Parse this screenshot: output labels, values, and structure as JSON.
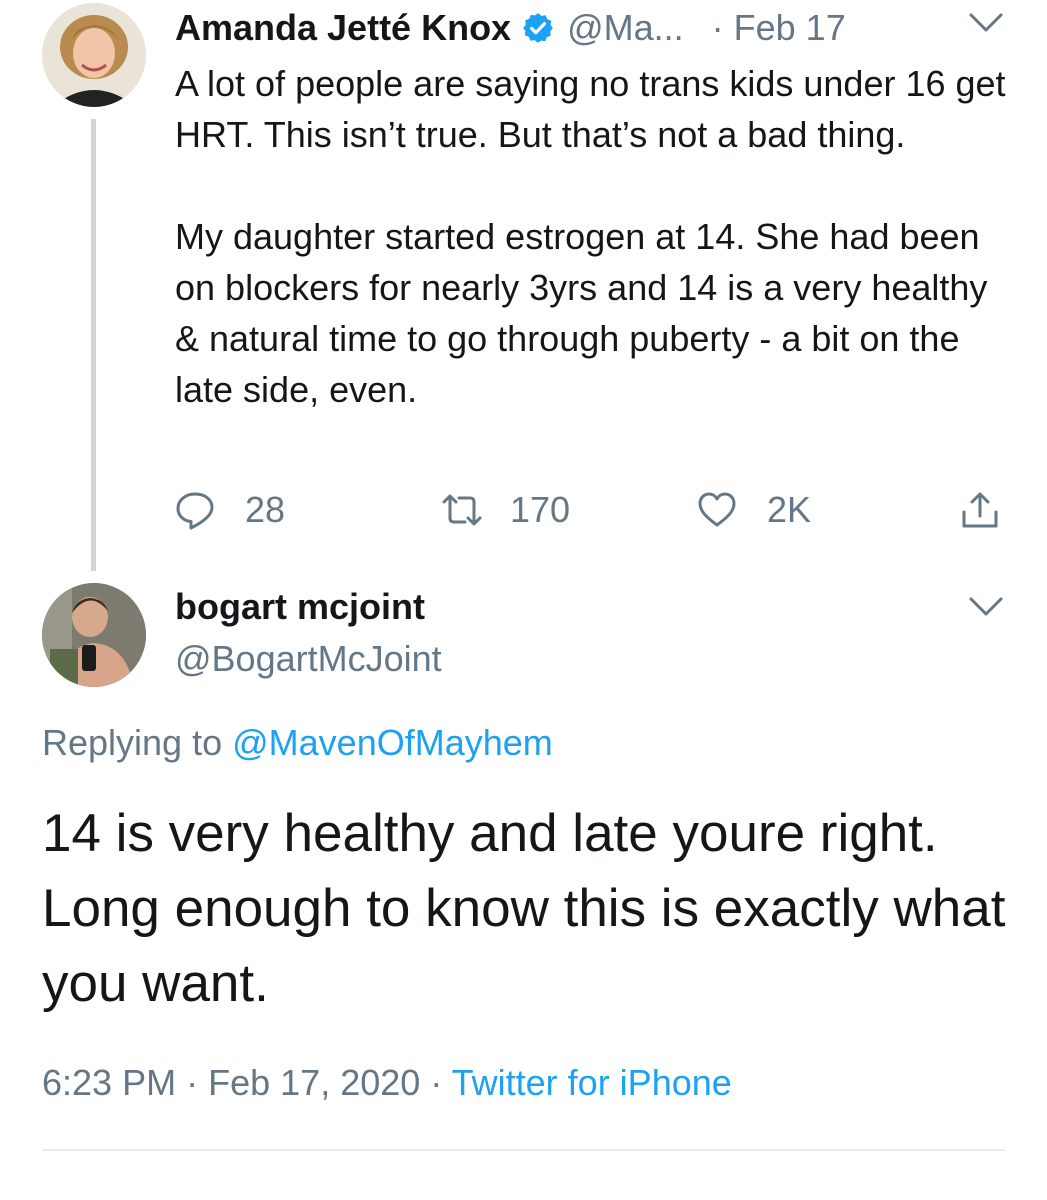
{
  "parent_tweet": {
    "author_name": "Amanda Jetté Knox",
    "author_handle": "@Ma...",
    "separator": "·",
    "date": "Feb 17",
    "text_paragraphs": [
      "A lot of people are saying no trans kids under 16 get HRT. This isn’t true. But that’s not a bad thing.",
      "My daughter started estrogen at 14. She had been on blockers for nearly 3yrs and 14 is a very healthy & natural time to go through puberty - a bit on the late side, even."
    ],
    "actions": {
      "reply_count": "28",
      "retweet_count": "170",
      "like_count": "2K"
    },
    "icons": [
      "verified-badge-icon",
      "chevron-down-icon",
      "reply-icon",
      "retweet-icon",
      "like-icon",
      "share-icon"
    ]
  },
  "reply_tweet": {
    "author_name": "bogart mcjoint",
    "author_handle": "@BogartMcJoint",
    "replying_prefix": "Replying to",
    "replying_to": "@MavenOfMayhem",
    "text": "14 is very healthy and late youre right. Long enough to know this is exactly what you want.",
    "time": "6:23 PM",
    "separator": "·",
    "date": "Feb 17, 2020",
    "client": "Twitter for iPhone"
  },
  "colors": {
    "text": "#14171a",
    "secondary": "#657786",
    "link": "#1da1f2",
    "verified": "#1da1f2",
    "thread_line": "#cdd5db",
    "divider": "#e6ecf0"
  }
}
